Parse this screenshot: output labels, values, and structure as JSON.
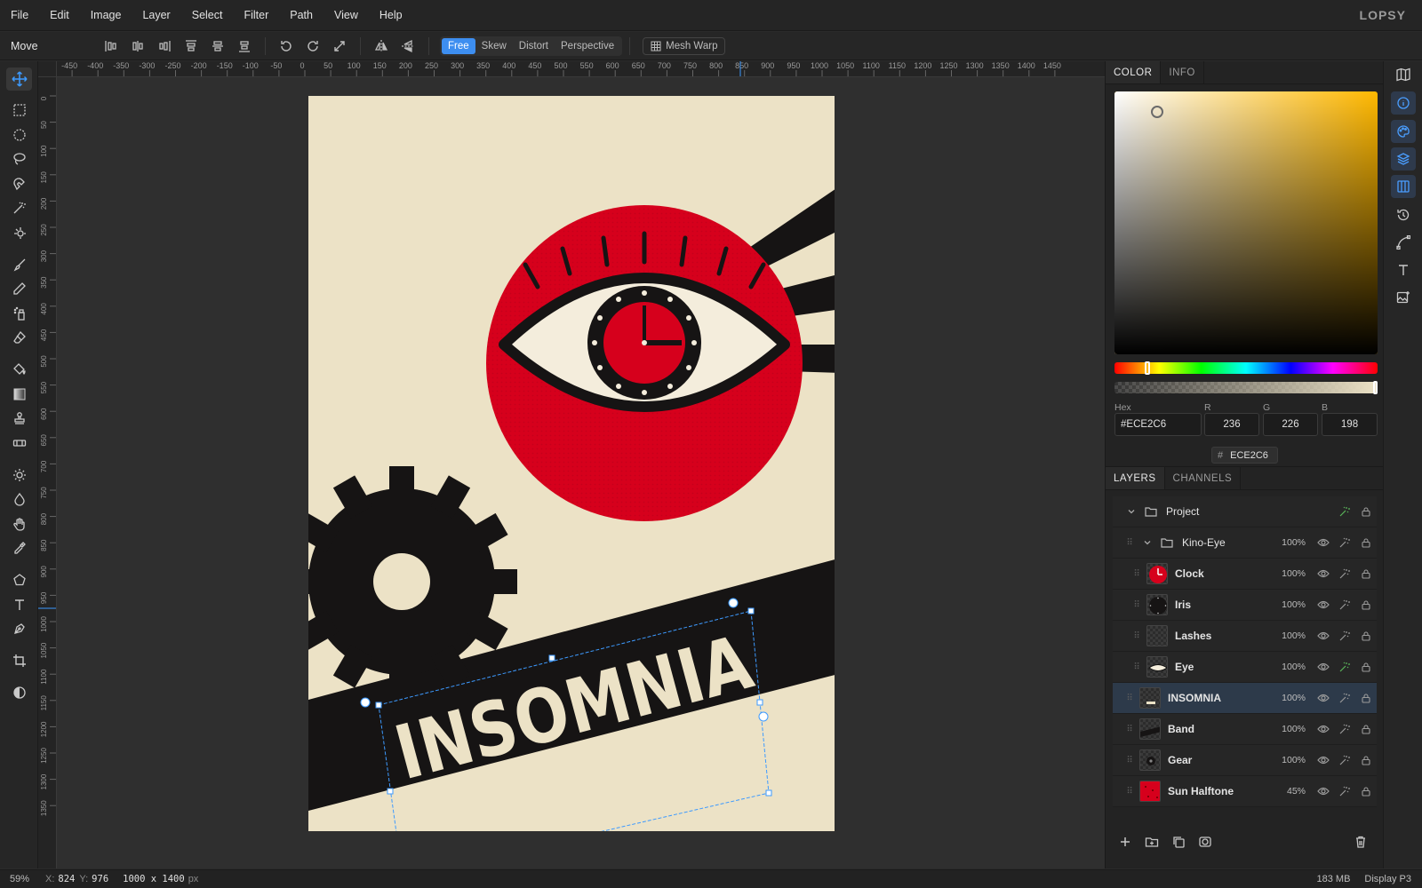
{
  "menubar": {
    "items": [
      "File",
      "Edit",
      "Image",
      "Layer",
      "Select",
      "Filter",
      "Path",
      "View",
      "Help"
    ],
    "brand": "LOPSY"
  },
  "options": {
    "tool_name": "Move",
    "transform_modes": [
      "Free",
      "Skew",
      "Distort",
      "Perspective"
    ],
    "active_mode": "Free",
    "mesh_warp_label": "Mesh Warp"
  },
  "rulers": {
    "top": [
      "-450",
      "-400",
      "-350",
      "-300",
      "-250",
      "-200",
      "-150",
      "-100",
      "-50",
      "0",
      "50",
      "100",
      "150",
      "200",
      "250",
      "300",
      "350",
      "400",
      "450",
      "500",
      "550",
      "600",
      "650",
      "700",
      "750",
      "800",
      "850",
      "900",
      "950",
      "1000",
      "1050",
      "1100",
      "1150",
      "1200",
      "1250",
      "1300",
      "1350",
      "1400",
      "1450"
    ],
    "left": [
      "0",
      "50",
      "100",
      "150",
      "200",
      "250",
      "300",
      "350",
      "400",
      "450",
      "500",
      "550",
      "600",
      "650",
      "700",
      "750",
      "800",
      "850",
      "900",
      "950",
      "1000",
      "1050",
      "1100",
      "1150",
      "1200",
      "1250",
      "1300",
      "1350"
    ]
  },
  "poster": {
    "headline": "INSOMNIA",
    "colors": {
      "paper": "#ECE2C6",
      "red": "#D6001C",
      "ink": "#161414"
    }
  },
  "color_panel": {
    "tabs": [
      "COLOR",
      "INFO"
    ],
    "active_tab": "COLOR",
    "hex_label": "Hex",
    "hex_value": "#ECE2C6",
    "r_label": "R",
    "r_value": "236",
    "g_label": "G",
    "g_value": "226",
    "b_label": "B",
    "b_value": "198",
    "swatch_hash": "#",
    "swatch_value": "ECE2C6",
    "hue_color": "#FFB800"
  },
  "layers_panel": {
    "tabs": [
      "LAYERS",
      "CHANNELS"
    ],
    "active_tab": "LAYERS",
    "layers": [
      {
        "name": "Project",
        "opacity": "",
        "type": "group",
        "level": 0
      },
      {
        "name": "Kino-Eye",
        "opacity": "100%",
        "type": "group",
        "level": 1
      },
      {
        "name": "Clock",
        "opacity": "100%",
        "type": "layer",
        "level": 2
      },
      {
        "name": "Iris",
        "opacity": "100%",
        "type": "layer",
        "level": 2
      },
      {
        "name": "Lashes",
        "opacity": "100%",
        "type": "layer",
        "level": 2
      },
      {
        "name": "Eye",
        "opacity": "100%",
        "type": "layer",
        "level": 2
      },
      {
        "name": "INSOMNIA",
        "opacity": "100%",
        "type": "layer",
        "level": 1,
        "selected": true
      },
      {
        "name": "Band",
        "opacity": "100%",
        "type": "layer",
        "level": 1
      },
      {
        "name": "Gear",
        "opacity": "100%",
        "type": "layer",
        "level": 1
      },
      {
        "name": "Sun Halftone",
        "opacity": "45%",
        "type": "layer",
        "level": 1
      }
    ]
  },
  "status": {
    "zoom": "59%",
    "x_label": "X:",
    "x_value": "824",
    "y_label": "Y:",
    "y_value": "976",
    "doc_size": "1000 x 1400",
    "doc_unit": "px",
    "memory": "183 MB",
    "color_profile": "Display P3"
  }
}
